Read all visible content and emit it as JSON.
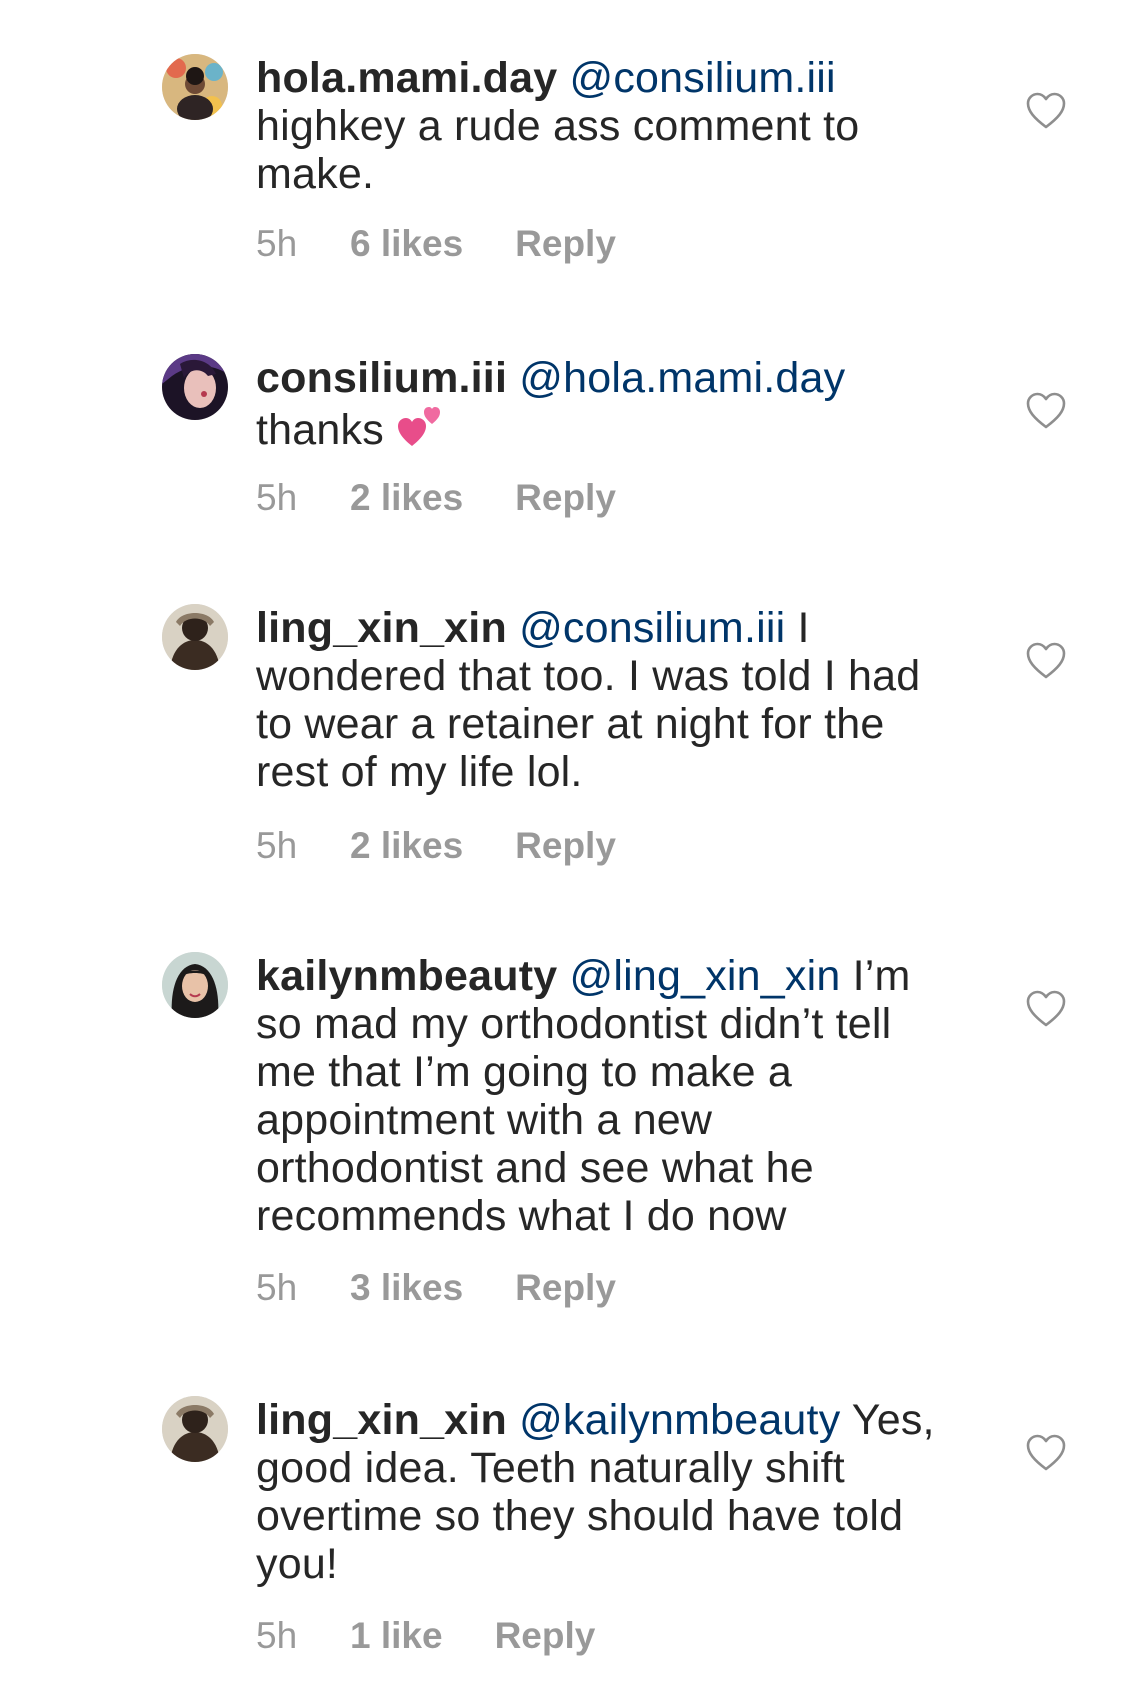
{
  "comments": [
    {
      "username": "hola.mami.day",
      "mention": "@consilium.iii",
      "text": "highkey a rude ass comment to make.",
      "time": "5h",
      "likes": "6 likes",
      "reply": "Reply",
      "avatar_colors": [
        "#c9b089",
        "#e26a4e",
        "#3a2a24"
      ]
    },
    {
      "username": "consilium.iii",
      "mention": "@hola.mami.day",
      "text": "thanks",
      "emoji": "two-hearts-icon",
      "time": "5h",
      "likes": "2 likes",
      "reply": "Reply",
      "avatar_colors": [
        "#2b1a3a",
        "#7a4fa8",
        "#e6b7b7"
      ]
    },
    {
      "username": "ling_xin_xin",
      "mention": "@consilium.iii",
      "text": "I wondered that too. I was told I had to wear a retainer at night for the rest of my life lol.",
      "time": "5h",
      "likes": "2 likes",
      "reply": "Reply",
      "avatar_colors": [
        "#d9d2c4",
        "#4a3a2e",
        "#8b7a66"
      ]
    },
    {
      "username": "kailynmbeauty",
      "mention": "@ling_xin_xin",
      "text": "I’m so mad my orthodontist didn’t tell me that I’m going to make a appointment with a new orthodontist and see what he recommends what I do now",
      "time": "5h",
      "likes": "3 likes",
      "reply": "Reply",
      "avatar_colors": [
        "#c8d6d2",
        "#1c1a1a",
        "#e8c2a8"
      ]
    },
    {
      "username": "ling_xin_xin",
      "mention": "@kailynmbeauty",
      "text": "Yes, good idea. Teeth naturally shift overtime so they should have told you!",
      "time": "5h",
      "likes": "1 like",
      "reply": "Reply",
      "avatar_colors": [
        "#d9d2c4",
        "#4a3a2e",
        "#8b7a66"
      ]
    }
  ],
  "colors": {
    "text": "#262626",
    "mention": "#003569",
    "meta": "#999999",
    "heart_stroke": "#8e8e8e",
    "emoji": "#e84d8a"
  },
  "icons": {
    "like": "heart-outline-icon"
  }
}
